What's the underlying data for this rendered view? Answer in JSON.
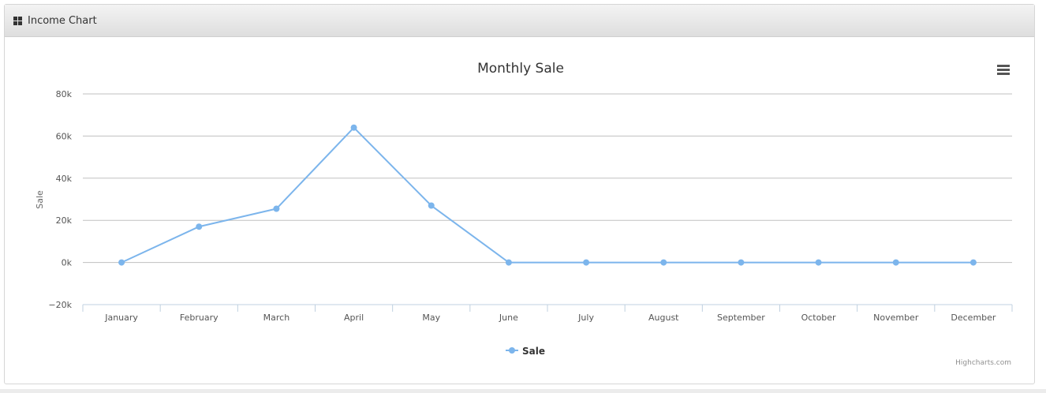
{
  "panel": {
    "title": "Income Chart",
    "icon": "grid-icon"
  },
  "chart_data": {
    "type": "line",
    "title": "Monthly Sale",
    "xlabel": "",
    "ylabel": "Sale",
    "categories": [
      "January",
      "February",
      "March",
      "April",
      "May",
      "June",
      "July",
      "August",
      "September",
      "October",
      "November",
      "December"
    ],
    "series": [
      {
        "name": "Sale",
        "color": "#7cb5ec",
        "values": [
          0,
          17000,
          25500,
          64000,
          27000,
          0,
          0,
          0,
          0,
          0,
          0,
          0
        ]
      }
    ],
    "ylim": [
      -20000,
      80000
    ],
    "yticks": [
      {
        "value": 80000,
        "label": "80k"
      },
      {
        "value": 60000,
        "label": "60k"
      },
      {
        "value": 40000,
        "label": "40k"
      },
      {
        "value": 20000,
        "label": "20k"
      },
      {
        "value": 0,
        "label": "0k"
      },
      {
        "value": -20000,
        "label": "−20k"
      }
    ],
    "grid": true,
    "legend": "bottom-center",
    "menu_icon": "hamburger-menu-icon",
    "credits": "Highcharts.com"
  }
}
